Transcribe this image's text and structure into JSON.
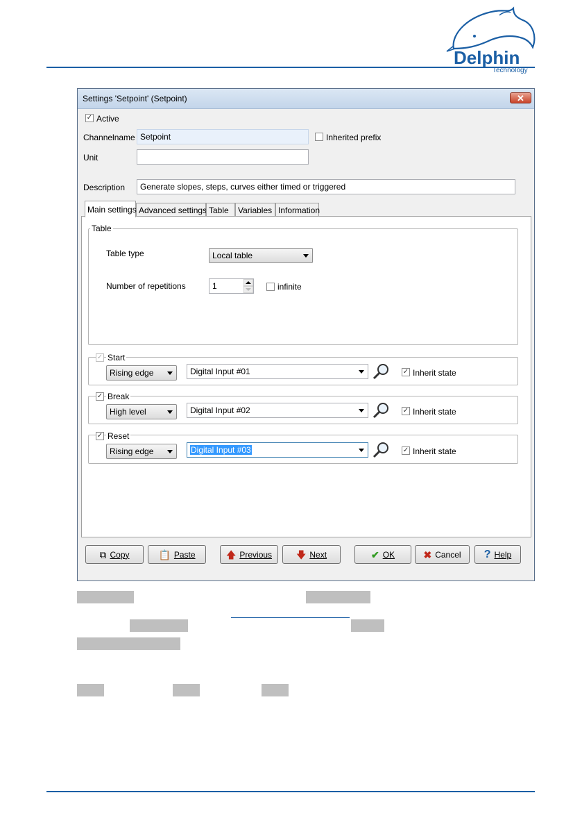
{
  "logo": {
    "name": "Delphin",
    "sub": "Technology"
  },
  "dialog": {
    "title": "Settings 'Setpoint' (Setpoint)",
    "close_glyph": "✕",
    "active_label": "Active",
    "active_checked": true,
    "channelname_label": "Channelname",
    "channelname_value": "Setpoint",
    "inherited_prefix_label": "Inherited prefix",
    "inherited_prefix_checked": false,
    "unit_label": "Unit",
    "unit_value": "",
    "description_label": "Description",
    "description_value": "Generate slopes, steps, curves either timed or triggered",
    "tabs": [
      {
        "label": "Main settings",
        "active": true
      },
      {
        "label": "Advanced settings",
        "active": false
      },
      {
        "label": "Table",
        "active": false
      },
      {
        "label": "Variables",
        "active": false
      },
      {
        "label": "Information",
        "active": false
      }
    ],
    "table_group": {
      "label": "Table",
      "table_type_label": "Table type",
      "table_type_value": "Local table",
      "repetitions_label": "Number of repetitions",
      "repetitions_value": "1",
      "infinite_label": "infinite",
      "infinite_checked": false
    },
    "triggers": [
      {
        "label": "Start",
        "checked": true,
        "disabled": true,
        "edge": "Rising edge",
        "input": "Digital Input #01",
        "inherit_label": "Inherit state",
        "inherit_checked": true
      },
      {
        "label": "Break",
        "checked": true,
        "disabled": false,
        "edge": "High level",
        "input": "Digital Input #02",
        "inherit_label": "Inherit state",
        "inherit_checked": true
      },
      {
        "label": "Reset",
        "checked": true,
        "disabled": false,
        "edge": "Rising edge",
        "input": "Digital Input #03",
        "inherit_label": "Inherit state",
        "inherit_checked": true,
        "input_selected": true
      }
    ],
    "buttons": {
      "copy": "Copy",
      "paste": "Paste",
      "previous": "Previous",
      "next": "Next",
      "ok": "OK",
      "cancel": "Cancel",
      "help": "Help"
    }
  },
  "colors": {
    "rule": "#1b5fa5",
    "logo": "#1b5fa5"
  }
}
